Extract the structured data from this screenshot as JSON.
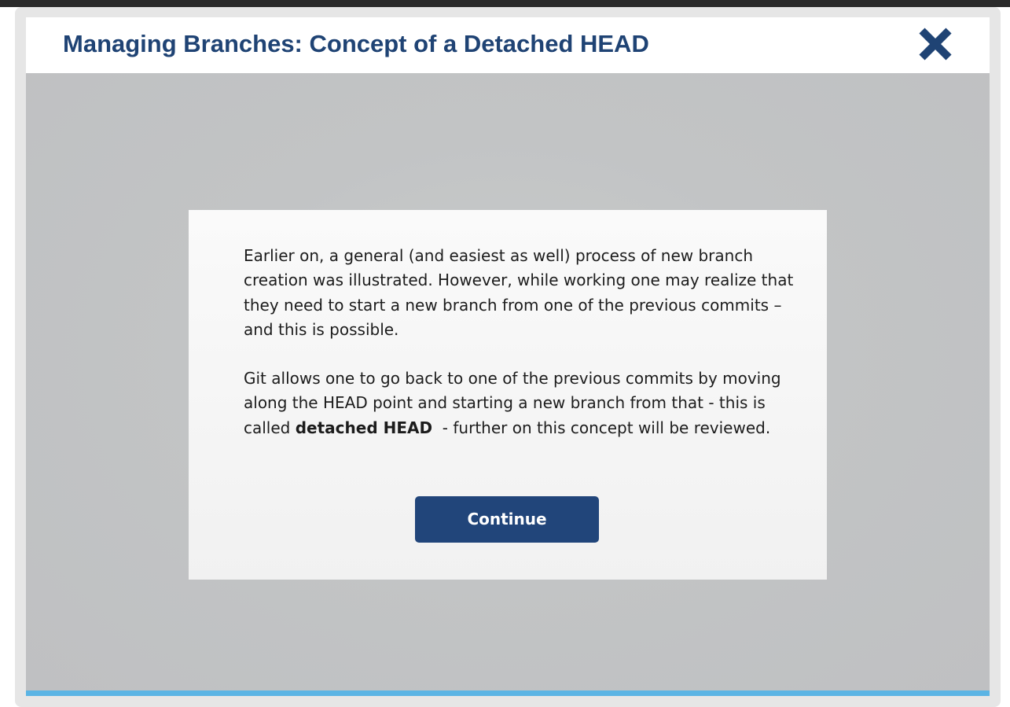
{
  "header": {
    "title": "Managing Branches: Concept of a Detached HEAD",
    "close_icon": "close-icon"
  },
  "dialog": {
    "paragraph1": "Earlier on, a general (and easiest as well) process of new branch creation was illustrated. However, while working one may realize that they need to start a new branch from one of the previous commits – and this is possible.",
    "paragraph2_before": "Git allows one to go back to one of the previous commits by moving along the HEAD point and starting a new branch from that - this is called ",
    "paragraph2_bold": "detached HEAD",
    "paragraph2_after": "  - further on this concept will be reviewed.",
    "continue_label": "Continue"
  },
  "colors": {
    "title": "#1f4374",
    "close_icon": "#1f4374",
    "button_bg": "#21457a",
    "stage_bg": "#c2c4c5",
    "progress_bar": "#5bb4e4"
  }
}
